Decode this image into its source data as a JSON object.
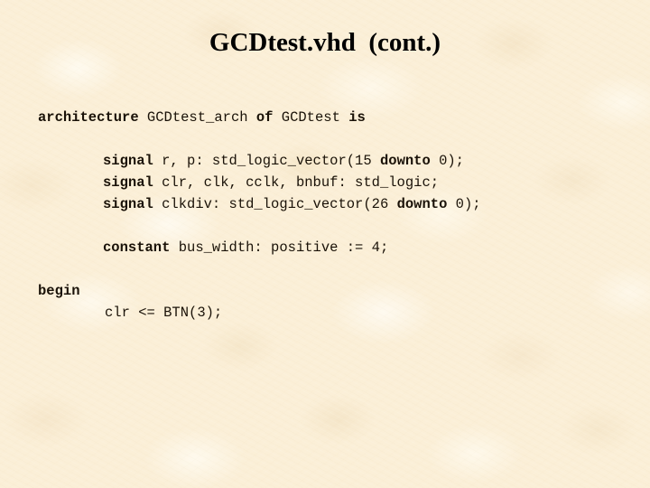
{
  "slide": {
    "title": "GCDtest.vhd  (cont.)",
    "background_color": "#fbefd7",
    "text_color": "#1a1208",
    "title_color": "#000000"
  },
  "code": {
    "language": "vhdl",
    "lines": [
      {
        "id": "architecture-decl",
        "indent": "indent-0",
        "segments": [
          {
            "text": "architecture",
            "bold": true
          },
          {
            "text": " GCDtest_arch ",
            "bold": false
          },
          {
            "text": "of",
            "bold": true
          },
          {
            "text": " GCDtest ",
            "bold": false
          },
          {
            "text": "is",
            "bold": true
          }
        ]
      },
      {
        "id": "blank-1",
        "indent": "indent-0",
        "segments": [
          {
            "text": " ",
            "bold": false
          }
        ]
      },
      {
        "id": "signal-r-p",
        "indent": "indent-1",
        "segments": [
          {
            "text": "signal",
            "bold": true
          },
          {
            "text": " r, p: std_logic_vector(15 ",
            "bold": false
          },
          {
            "text": "downto",
            "bold": true
          },
          {
            "text": " 0);",
            "bold": false
          }
        ]
      },
      {
        "id": "signal-clr-clk-cclk-bnbuf",
        "indent": "indent-1",
        "segments": [
          {
            "text": "signal",
            "bold": true
          },
          {
            "text": " clr, clk, cclk, bnbuf: std_logic;",
            "bold": false
          }
        ]
      },
      {
        "id": "signal-clkdiv",
        "indent": "indent-1",
        "segments": [
          {
            "text": "signal",
            "bold": true
          },
          {
            "text": " clkdiv: std_logic_vector(26 ",
            "bold": false
          },
          {
            "text": "downto",
            "bold": true
          },
          {
            "text": " 0);",
            "bold": false
          }
        ]
      },
      {
        "id": "blank-2",
        "indent": "indent-1",
        "segments": [
          {
            "text": " ",
            "bold": false
          }
        ]
      },
      {
        "id": "constant-bus-width",
        "indent": "indent-1",
        "segments": [
          {
            "text": "constant",
            "bold": true
          },
          {
            "text": " bus_width: positive := 4;",
            "bold": false
          }
        ]
      },
      {
        "id": "blank-3",
        "indent": "indent-0",
        "segments": [
          {
            "text": " ",
            "bold": false
          }
        ]
      },
      {
        "id": "begin-keyword",
        "indent": "indent-0",
        "segments": [
          {
            "text": "begin",
            "bold": true
          }
        ]
      },
      {
        "id": "clr-assignment",
        "indent": "indent-stmt",
        "segments": [
          {
            "text": "clr <= BTN(3);",
            "bold": false
          }
        ]
      }
    ]
  }
}
